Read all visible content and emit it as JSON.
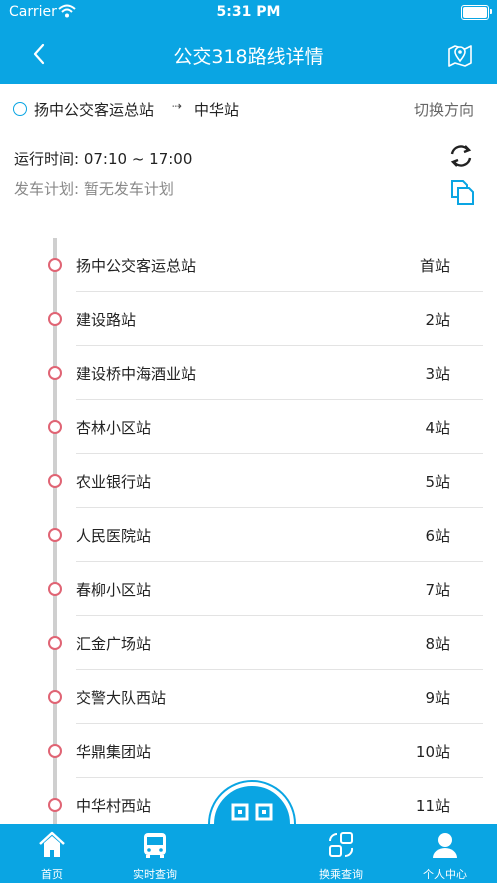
{
  "status_bar": {
    "carrier": "Carrier",
    "time": "5:31 PM"
  },
  "header": {
    "title": "公交318路线详情",
    "back_icon": "chevron-left-icon",
    "map_icon": "map-pin-icon"
  },
  "direction": {
    "from": "扬中公交客运总站",
    "arrow": "⇢",
    "to": "中华站",
    "switch_label": "切换方向"
  },
  "info": {
    "hours": "运行时间: 07:10 ~ 17:00",
    "schedule": "发车计划: 暂无发车计划"
  },
  "stops": [
    {
      "name": "扬中公交客运总站",
      "no": "首站"
    },
    {
      "name": "建设路站",
      "no": "2站"
    },
    {
      "name": "建设桥中海酒业站",
      "no": "3站"
    },
    {
      "name": "杏林小区站",
      "no": "4站"
    },
    {
      "name": "农业银行站",
      "no": "5站"
    },
    {
      "name": "人民医院站",
      "no": "6站"
    },
    {
      "name": "春柳小区站",
      "no": "7站"
    },
    {
      "name": "汇金广场站",
      "no": "8站"
    },
    {
      "name": "交警大队西站",
      "no": "9站"
    },
    {
      "name": "华鼎集团站",
      "no": "10站"
    },
    {
      "name": "中华村西站",
      "no": "11站"
    }
  ],
  "tabs": [
    {
      "label": "首页",
      "icon": "home-icon"
    },
    {
      "label": "实时查询",
      "icon": "bus-icon"
    },
    {
      "label": "换乘查询",
      "icon": "transfer-icon"
    },
    {
      "label": "个人中心",
      "icon": "user-icon"
    }
  ],
  "colors": {
    "primary": "#0aa5e3",
    "stop_dot": "#e06474"
  }
}
